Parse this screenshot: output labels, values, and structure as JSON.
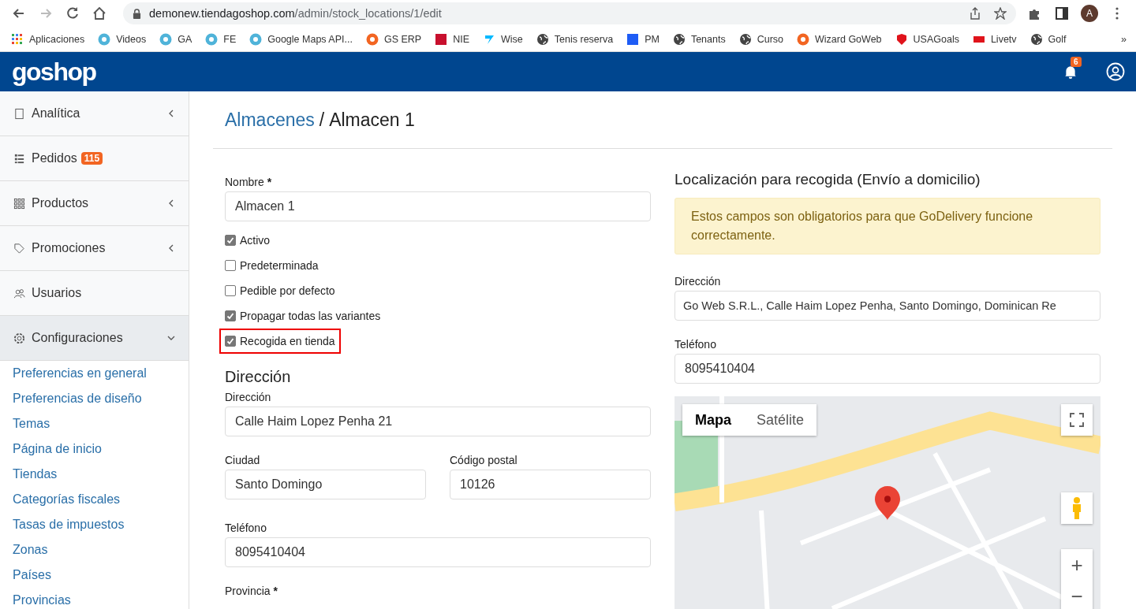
{
  "browser": {
    "url_host": "demonew.tiendagoshop.com",
    "url_path": "/admin/stock_locations/1/edit",
    "avatar": "A",
    "bookmarks": [
      {
        "label": "Aplicaciones",
        "kind": "apps"
      },
      {
        "label": "Videos",
        "kind": "k"
      },
      {
        "label": "GA",
        "kind": "k"
      },
      {
        "label": "FE",
        "kind": "k"
      },
      {
        "label": "Google Maps API...",
        "kind": "k"
      },
      {
        "label": "GS ERP",
        "kind": "go"
      },
      {
        "label": "NIE",
        "kind": "crest"
      },
      {
        "label": "Wise",
        "kind": "wise"
      },
      {
        "label": "Tenis reserva",
        "kind": "globe"
      },
      {
        "label": "PM",
        "kind": "box"
      },
      {
        "label": "Tenants",
        "kind": "globe"
      },
      {
        "label": "Curso",
        "kind": "globe"
      },
      {
        "label": "Wizard GoWeb",
        "kind": "go"
      },
      {
        "label": "USAGoals",
        "kind": "shield"
      },
      {
        "label": "Livetv",
        "kind": "live"
      },
      {
        "label": "Golf",
        "kind": "globe"
      }
    ],
    "more": "»"
  },
  "header": {
    "logo": "goshop",
    "notifications": "6"
  },
  "sidebar": {
    "items": [
      {
        "label": "Analítica",
        "kind": "analytics",
        "expanded": false,
        "expandable": true
      },
      {
        "label": "Pedidos",
        "kind": "orders",
        "badge": "115",
        "expanded": false,
        "expandable": false
      },
      {
        "label": "Productos",
        "kind": "products",
        "expanded": false,
        "expandable": true
      },
      {
        "label": "Promociones",
        "kind": "promotions",
        "expanded": false,
        "expandable": true
      },
      {
        "label": "Usuarios",
        "kind": "users",
        "expanded": false,
        "expandable": false
      },
      {
        "label": "Configuraciones",
        "kind": "settings",
        "expanded": true,
        "expandable": true
      }
    ],
    "subitems": [
      "Preferencias en general",
      "Preferencias de diseño",
      "Temas",
      "Página de inicio",
      "Tiendas",
      "Categorías fiscales",
      "Tasas de impuestos",
      "Zonas",
      "Países",
      "Provincias"
    ]
  },
  "page": {
    "breadcrumb_link": "Almacenes",
    "separator": "/",
    "title": "Almacen 1"
  },
  "form": {
    "name": {
      "label": "Nombre",
      "required": "*",
      "value": "Almacen 1"
    },
    "checkboxes": [
      {
        "label": "Activo",
        "checked": true,
        "highlighted": false
      },
      {
        "label": "Predeterminada",
        "checked": false,
        "highlighted": false
      },
      {
        "label": "Pedible por defecto",
        "checked": false,
        "highlighted": false
      },
      {
        "label": "Propagar todas las variantes",
        "checked": true,
        "highlighted": false
      },
      {
        "label": "Recogida en tienda",
        "checked": true,
        "highlighted": true
      }
    ],
    "address_heading": "Dirección",
    "address": {
      "label": "Dirección",
      "value": "Calle Haim Lopez Penha 21"
    },
    "city": {
      "label": "Ciudad",
      "value": "Santo Domingo"
    },
    "zip": {
      "label": "Código postal",
      "value": "10126"
    },
    "phone": {
      "label": "Teléfono",
      "value": "8095410404"
    },
    "province": {
      "label": "Provincia",
      "required": "*"
    }
  },
  "pickup": {
    "heading": "Localización para recogida (Envío a domicilio)",
    "alert": "Estos campos son obligatorios para que GoDelivery funcione correctamente.",
    "address": {
      "label": "Dirección",
      "value": "Go Web S.R.L., Calle Haim Lopez Penha, Santo Domingo, Dominican Re"
    },
    "phone": {
      "label": "Teléfono",
      "value": "8095410404"
    },
    "map": {
      "tabs": [
        {
          "label": "Mapa",
          "selected": true
        },
        {
          "label": "Satélite",
          "selected": false
        }
      ],
      "zoom_in": "+",
      "zoom_out": "−"
    }
  }
}
